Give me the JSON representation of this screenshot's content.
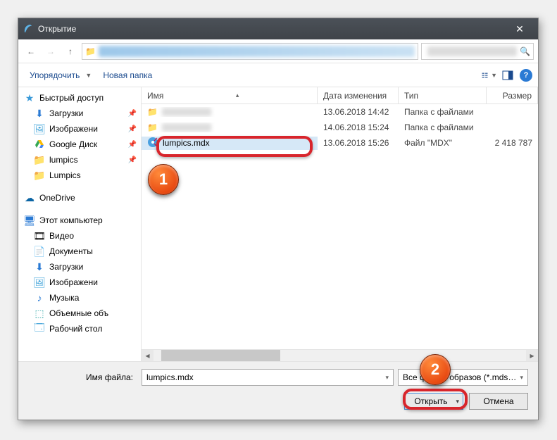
{
  "title": "Открытие",
  "toolbar": {
    "organize": "Упорядочить",
    "newfolder": "Новая папка"
  },
  "columns": {
    "name": "Имя",
    "date": "Дата изменения",
    "type": "Тип",
    "size": "Размер"
  },
  "sidebar": {
    "quickaccess": "Быстрый доступ",
    "downloads": "Загрузки",
    "images": "Изображени",
    "gdrive": "Google Диск",
    "lumpics_pin": "lumpics",
    "lumpics_folder": "Lumpics",
    "onedrive": "OneDrive",
    "thispc": "Этот компьютер",
    "video": "Видео",
    "documents": "Документы",
    "downloads2": "Загрузки",
    "images2": "Изображени",
    "music": "Музыка",
    "3d": "Объемные объ",
    "desktop": "Рабочий стол"
  },
  "files": {
    "row0": {
      "date": "13.06.2018 14:42",
      "type": "Папка с файлами"
    },
    "row1": {
      "date": "14.06.2018 15:24",
      "type": "Папка с файлами"
    },
    "row2": {
      "name": "lumpics.mdx",
      "date": "13.06.2018 15:26",
      "type": "Файл \"MDX\"",
      "size": "2 418 787"
    }
  },
  "footer": {
    "fnlabel": "Имя файла:",
    "fnvalue": "lumpics.mdx",
    "filter": "Все файлы образов (*.mds;*.md",
    "open": "Открыть",
    "cancel": "Отмена"
  },
  "badges": {
    "b1": "1",
    "b2": "2"
  }
}
